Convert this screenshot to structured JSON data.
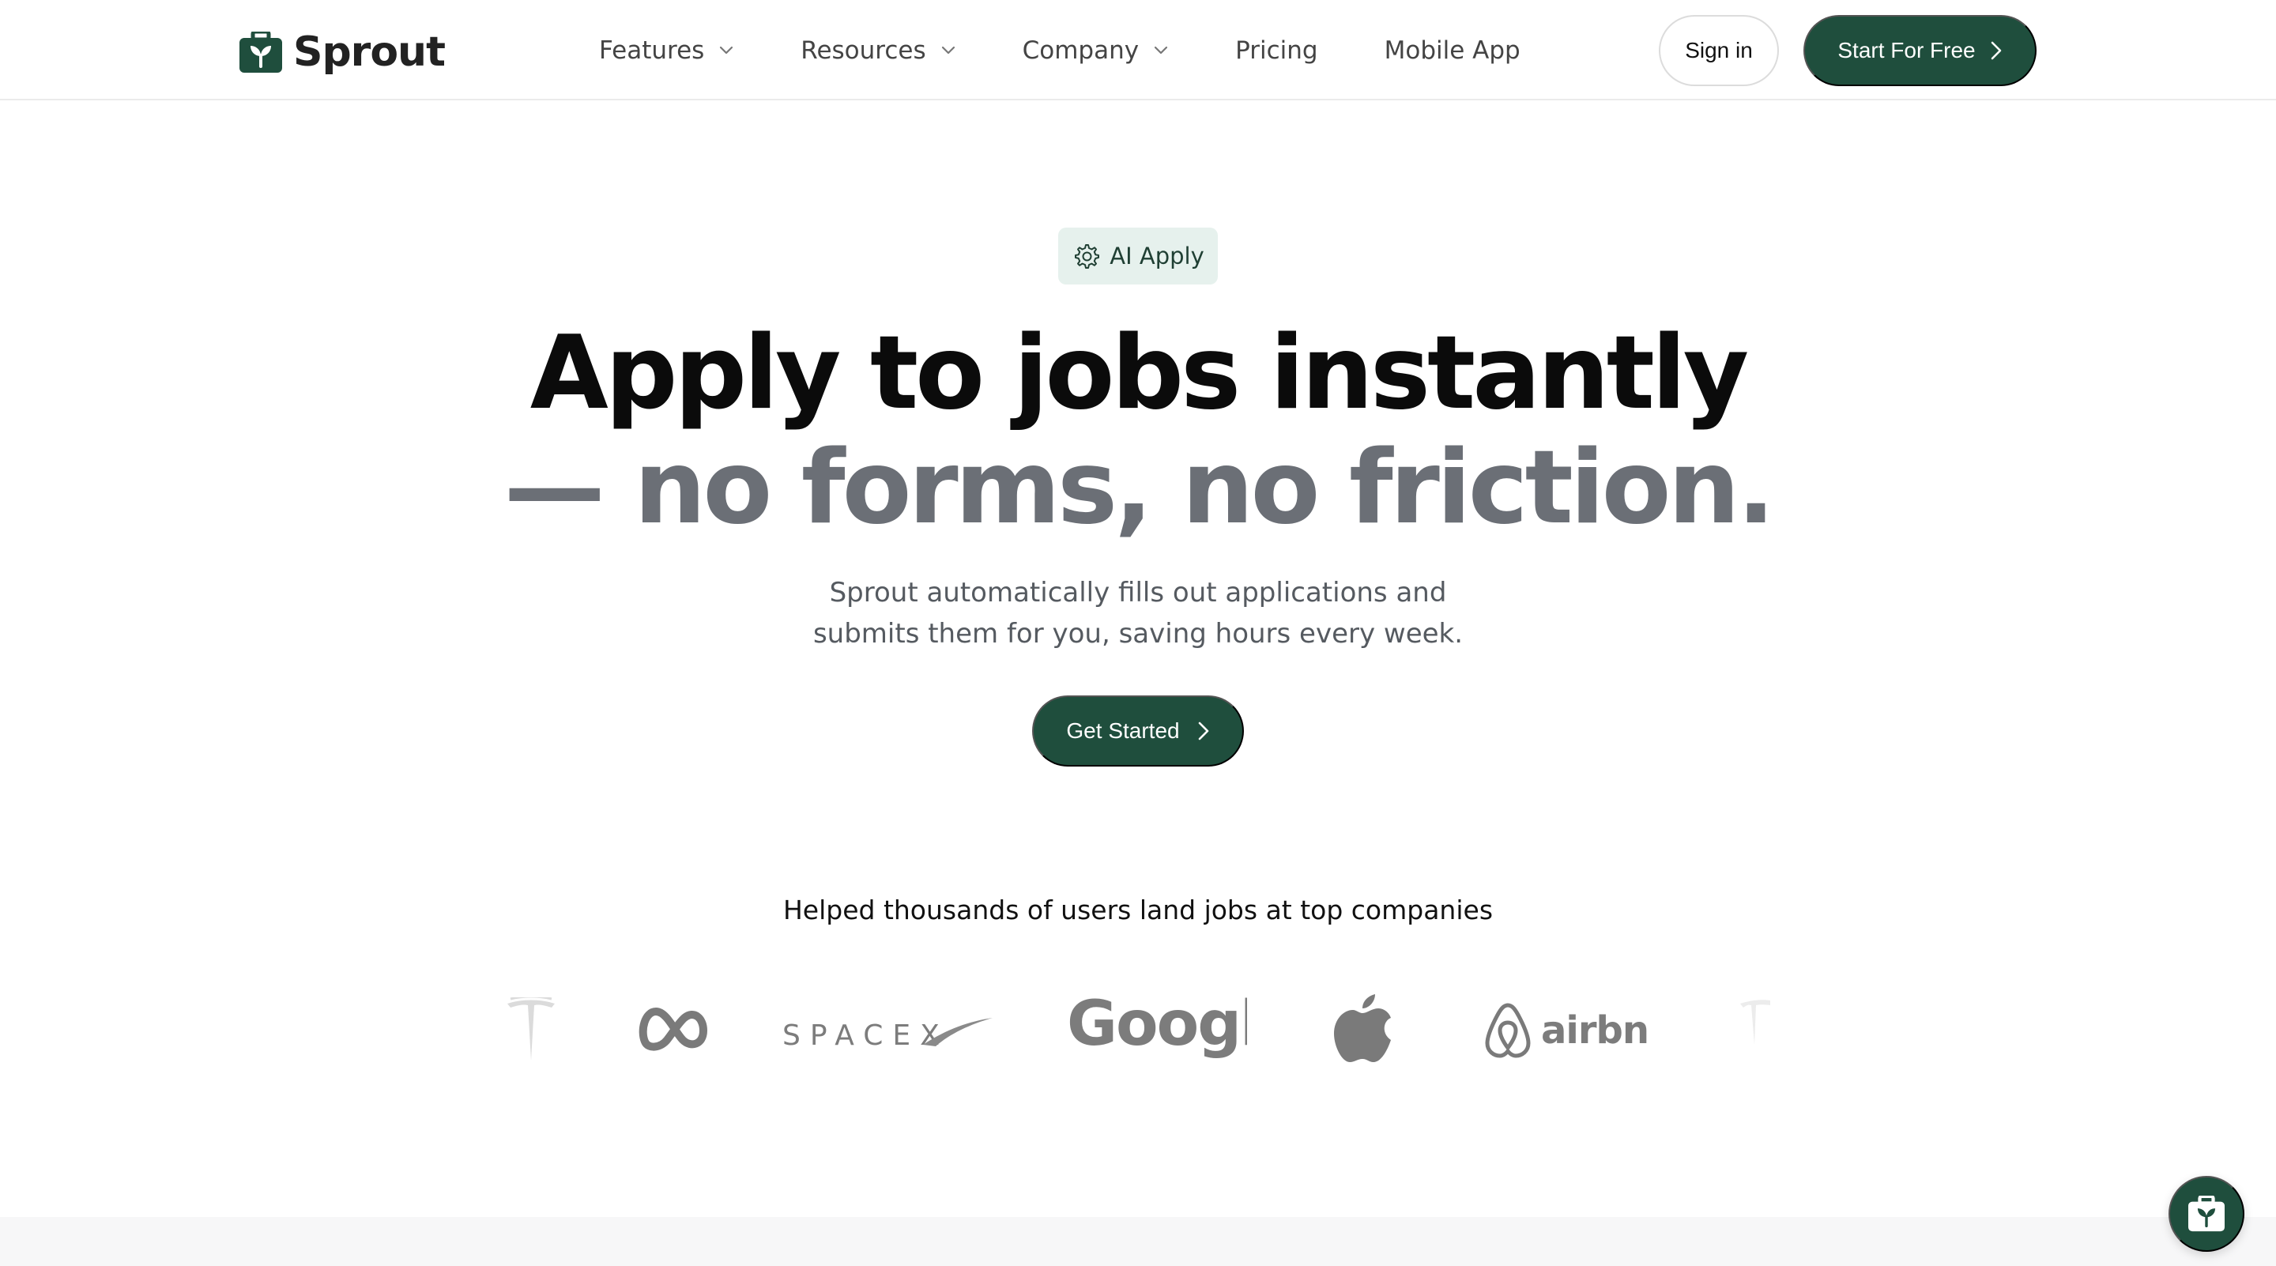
{
  "brand": {
    "name": "Sprout",
    "icon": "sprout-bag-icon"
  },
  "nav": {
    "items": [
      {
        "label": "Features",
        "dropdown": true
      },
      {
        "label": "Resources",
        "dropdown": true
      },
      {
        "label": "Company",
        "dropdown": true
      },
      {
        "label": "Pricing",
        "dropdown": false
      },
      {
        "label": "Mobile App",
        "dropdown": false
      }
    ],
    "sign_in": "Sign in",
    "start_free": "Start For Free"
  },
  "hero": {
    "badge": "AI Apply",
    "badge_icon": "gear-icon",
    "title_line1": "Apply to jobs instantly",
    "title_line2": "— no forms, no friction.",
    "subtitle_line1": "Sprout automatically fills out applications and",
    "subtitle_line2": "submits them for you, saving hours every week.",
    "cta": "Get Started"
  },
  "social_proof": {
    "heading": "Helped thousands of users land jobs at top companies",
    "logos": [
      {
        "name": "tesla-logo"
      },
      {
        "name": "meta-logo"
      },
      {
        "name": "spacex-logo",
        "text": "SPACEX"
      },
      {
        "name": "google-logo",
        "text": "Google"
      },
      {
        "name": "apple-logo"
      },
      {
        "name": "airbnb-logo",
        "text": "airbnb"
      },
      {
        "name": "tesla-logo"
      }
    ]
  },
  "chat_widget": {
    "icon": "sprout-bag-icon"
  },
  "colors": {
    "brand_green": "#1f4e3d",
    "badge_bg": "#e6f1ed",
    "title_dark": "#0b0b0b",
    "title_muted": "#6b6f76",
    "logo_gray": "#7c7c7c"
  }
}
